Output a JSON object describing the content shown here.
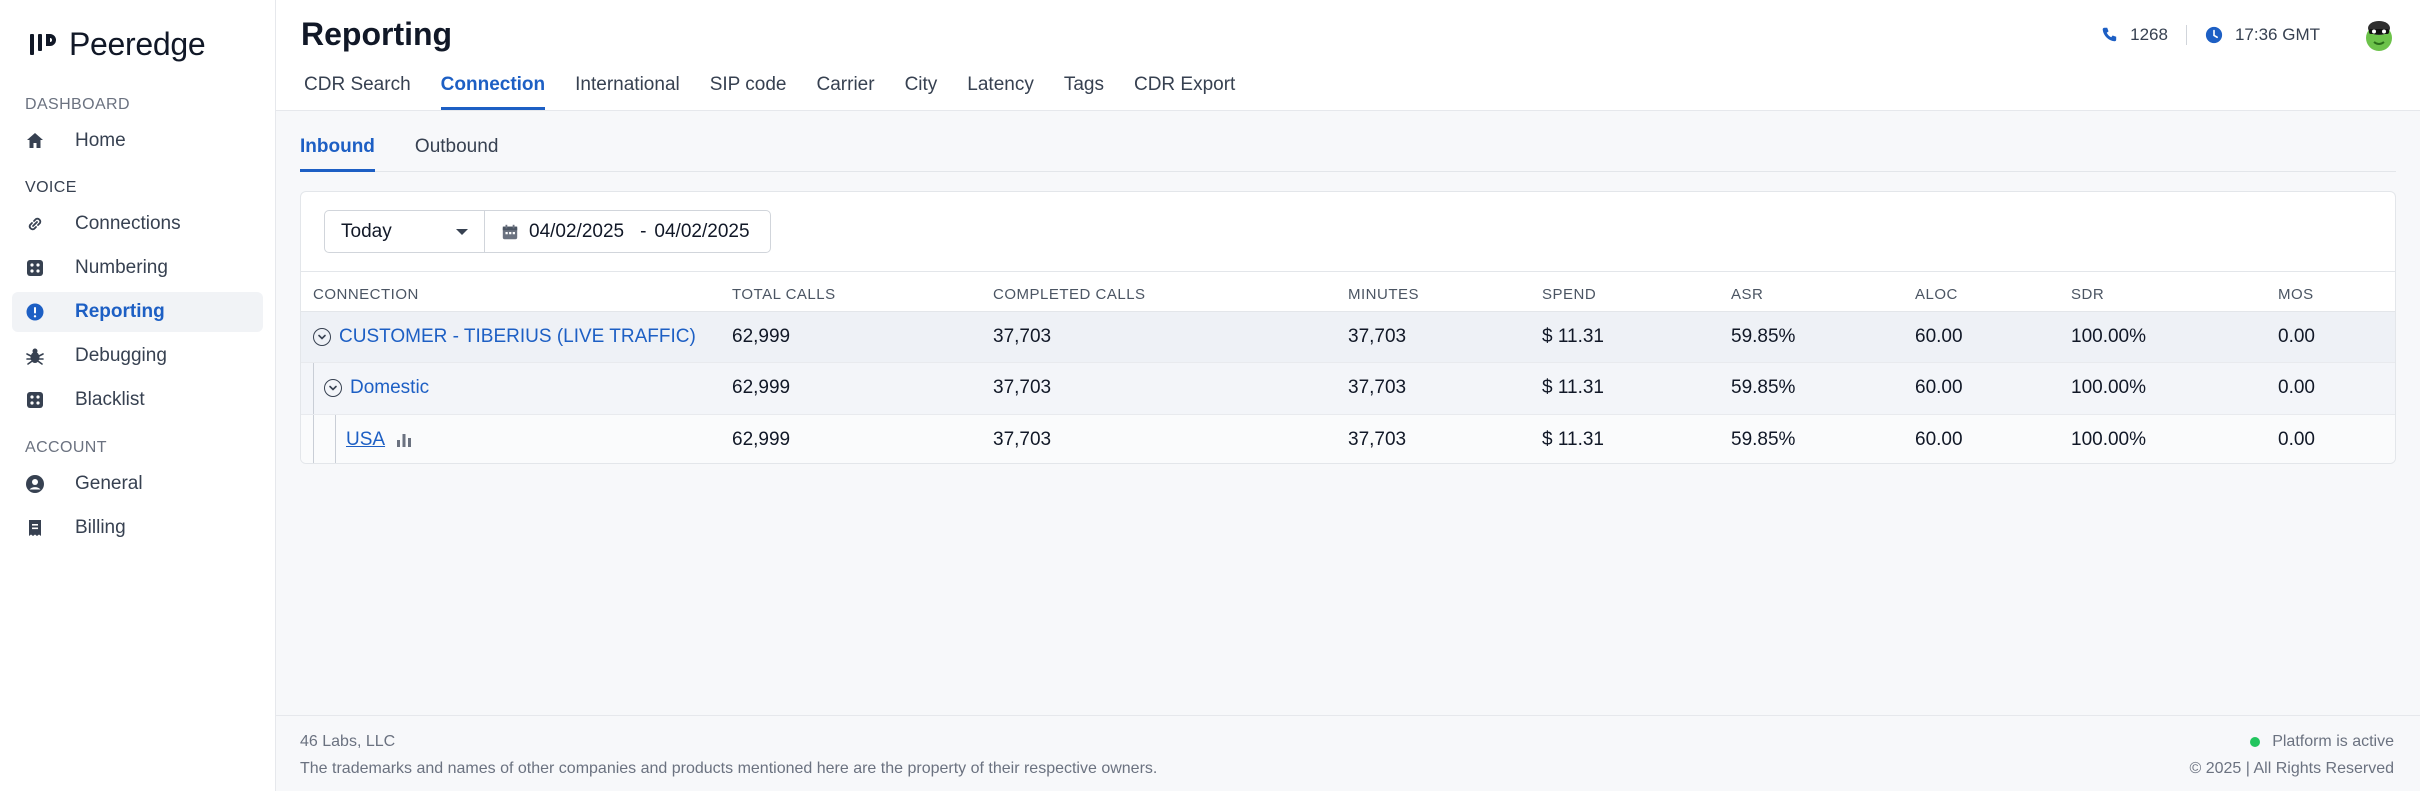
{
  "brand": {
    "name": "Peeredge"
  },
  "sidebar": {
    "sections": [
      {
        "label": "DASHBOARD"
      },
      {
        "label": "VOICE"
      },
      {
        "label": "ACCOUNT"
      }
    ],
    "items": [
      {
        "label": "Home",
        "icon": "home-icon"
      },
      {
        "label": "Connections",
        "icon": "link-icon"
      },
      {
        "label": "Numbering",
        "icon": "grid-icon"
      },
      {
        "label": "Reporting",
        "icon": "alert-circle-icon",
        "active": true
      },
      {
        "label": "Debugging",
        "icon": "bug-icon"
      },
      {
        "label": "Blacklist",
        "icon": "grid-icon"
      },
      {
        "label": "General",
        "icon": "user-circle-icon"
      },
      {
        "label": "Billing",
        "icon": "receipt-icon"
      }
    ]
  },
  "header": {
    "title": "Reporting",
    "phone": "1268",
    "time": "17:36 GMT",
    "tabs": [
      {
        "label": "CDR Search"
      },
      {
        "label": "Connection",
        "active": true
      },
      {
        "label": "International"
      },
      {
        "label": "SIP code"
      },
      {
        "label": "Carrier"
      },
      {
        "label": "City"
      },
      {
        "label": "Latency"
      },
      {
        "label": "Tags"
      },
      {
        "label": "CDR Export"
      }
    ]
  },
  "subtabs": [
    {
      "label": "Inbound",
      "active": true
    },
    {
      "label": "Outbound"
    }
  ],
  "filters": {
    "period": "Today",
    "date_from": "04/02/2025",
    "date_separator": "-",
    "date_to": "04/02/2025"
  },
  "table": {
    "columns": [
      "CONNECTION",
      "TOTAL CALLS",
      "COMPLETED CALLS",
      "MINUTES",
      "SPEND",
      "ASR",
      "ALOC",
      "SDR",
      "MOS"
    ],
    "rows": [
      {
        "name": "CUSTOMER - TIBERIUS (LIVE TRAFFIC)",
        "total_calls": "62,999",
        "completed_calls": "37,703",
        "minutes": "37,703",
        "spend": "$ 11.31",
        "asr": "59.85%",
        "aloc": "60.00",
        "sdr": "100.00%",
        "mos": "0.00"
      },
      {
        "name": "Domestic",
        "total_calls": "62,999",
        "completed_calls": "37,703",
        "minutes": "37,703",
        "spend": "$ 11.31",
        "asr": "59.85%",
        "aloc": "60.00",
        "sdr": "100.00%",
        "mos": "0.00"
      },
      {
        "name": "USA",
        "total_calls": "62,999",
        "completed_calls": "37,703",
        "minutes": "37,703",
        "spend": "$ 11.31",
        "asr": "59.85%",
        "aloc": "60.00",
        "sdr": "100.00%",
        "mos": "0.00"
      }
    ]
  },
  "footer": {
    "company": "46 Labs, LLC",
    "disclaimer": "The trademarks and names of other companies and products mentioned here are the property of their respective owners.",
    "status": "Platform is active",
    "copyright": "© 2025 | All Rights Reserved"
  },
  "colors": {
    "accent": "#1d5fc4",
    "status_active": "#22c55e"
  }
}
